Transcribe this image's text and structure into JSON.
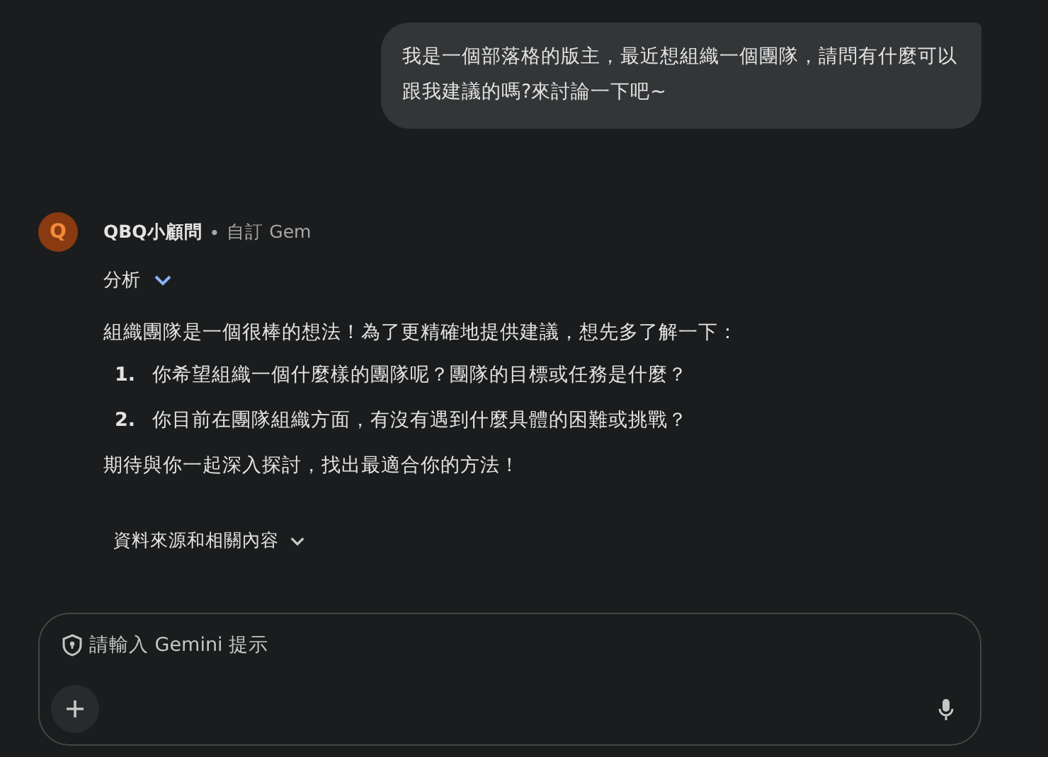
{
  "user_message": "我是一個部落格的版主，最近想組織一個團隊，請問有什麼可以跟我建議的嗎?來討論一下吧~",
  "response": {
    "avatar_letter": "Q",
    "name": "QBQ小顧問",
    "separator": "•",
    "subtitle": "自訂 Gem",
    "analysis_label": "分析",
    "analysis_expanded": false,
    "intro": "組織團隊是一個很棒的想法！為了更精確地提供建議，想先多了解一下：",
    "items": [
      {
        "number": "1.",
        "text": "你希望組織一個什麼樣的團隊呢？團隊的目標或任務是什麼？"
      },
      {
        "number": "2.",
        "text": "你目前在團隊組織方面，有沒有遇到什麼具體的困難或挑戰？"
      }
    ],
    "closing": "期待與你一起深入探討，找出最適合你的方法！",
    "sources_label": "資料來源和相關內容"
  },
  "input": {
    "placeholder": "請輸入 Gemini 提示"
  }
}
